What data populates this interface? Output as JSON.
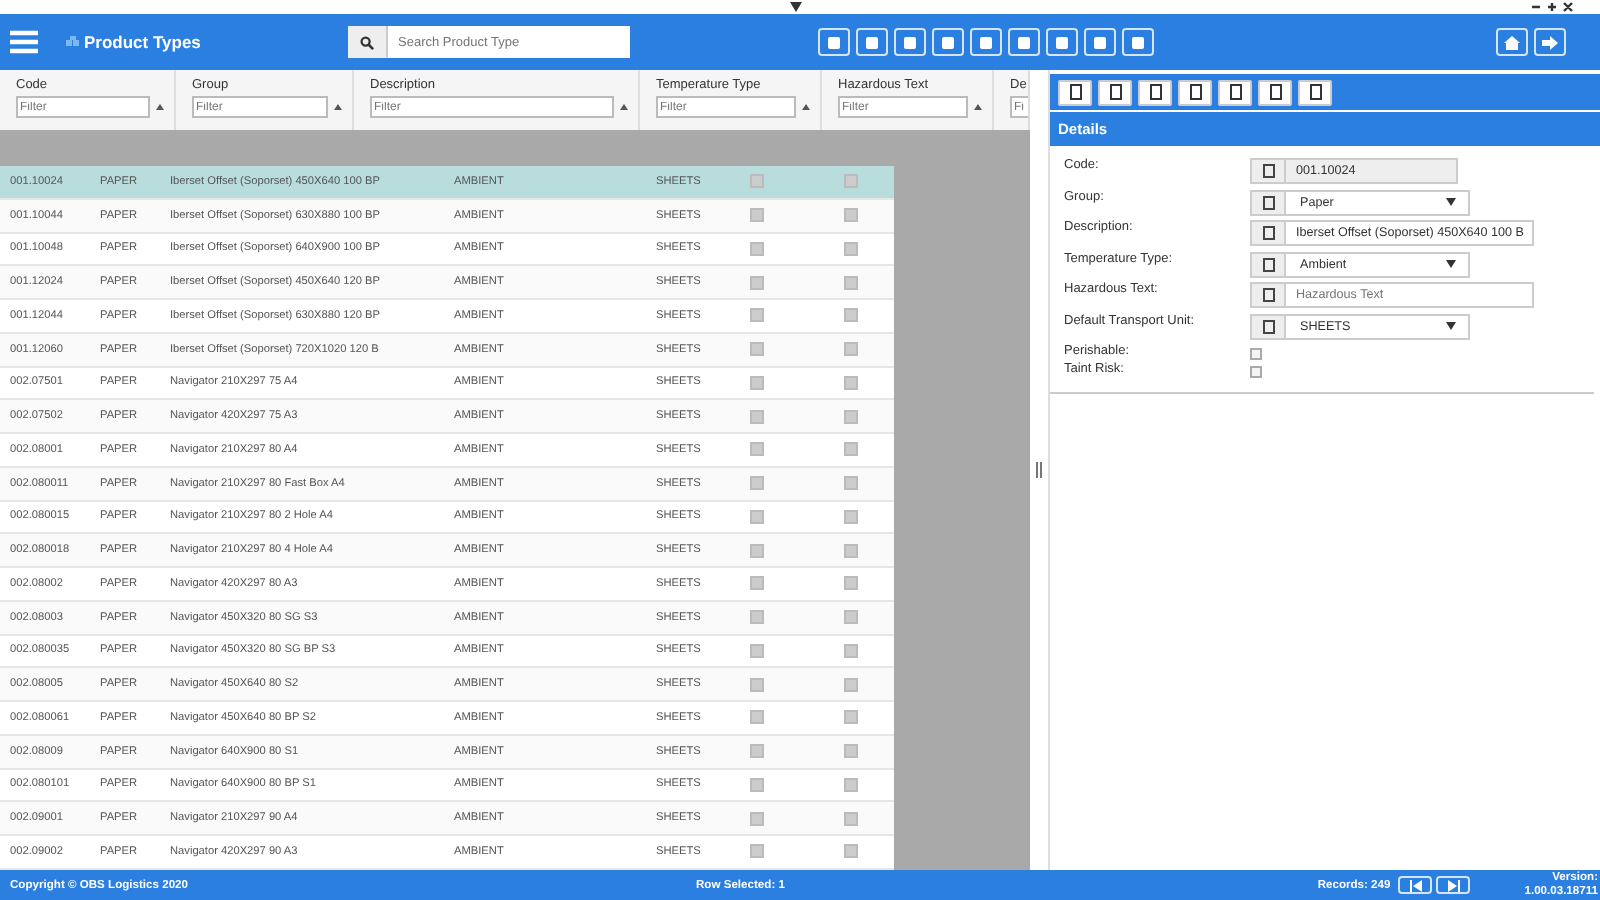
{
  "header": {
    "title": "Product Types",
    "search": {
      "placeholder": "Search Product Type"
    }
  },
  "filters": [
    {
      "label": "Code",
      "placeholder": "Filter"
    },
    {
      "label": "Group",
      "placeholder": "Filter"
    },
    {
      "label": "Description",
      "placeholder": "Filter"
    },
    {
      "label": "Temperature Type",
      "placeholder": "Filter"
    },
    {
      "label": "Hazardous Text",
      "placeholder": "Filter"
    },
    {
      "label": "De",
      "placeholder": "Fi"
    }
  ],
  "rows": [
    {
      "code": "001.10024",
      "group": "PAPER",
      "description": "Iberset Offset (Soporset) 450X640 100 BP",
      "temperature": "AMBIENT",
      "unit": "SHEETS",
      "check_a": false,
      "check_b": false,
      "selected": true
    },
    {
      "code": "001.10044",
      "group": "PAPER",
      "description": "Iberset Offset (Soporset) 630X880 100 BP",
      "temperature": "AMBIENT",
      "unit": "SHEETS",
      "check_a": false,
      "check_b": false,
      "selected": false
    },
    {
      "code": "001.10048",
      "group": "PAPER",
      "description": "Iberset Offset (Soporset) 640X900 100 BP",
      "temperature": "AMBIENT",
      "unit": "SHEETS",
      "check_a": false,
      "check_b": false,
      "selected": false
    },
    {
      "code": "001.12024",
      "group": "PAPER",
      "description": "Iberset Offset (Soporset) 450X640 120 BP",
      "temperature": "AMBIENT",
      "unit": "SHEETS",
      "check_a": false,
      "check_b": false,
      "selected": false
    },
    {
      "code": "001.12044",
      "group": "PAPER",
      "description": "Iberset Offset (Soporset) 630X880 120 BP",
      "temperature": "AMBIENT",
      "unit": "SHEETS",
      "check_a": false,
      "check_b": false,
      "selected": false
    },
    {
      "code": "001.12060",
      "group": "PAPER",
      "description": "Iberset Offset (Soporset) 720X1020 120 B",
      "temperature": "AMBIENT",
      "unit": "SHEETS",
      "check_a": false,
      "check_b": false,
      "selected": false
    },
    {
      "code": "002.07501",
      "group": "PAPER",
      "description": "Navigator 210X297 75 A4",
      "temperature": "AMBIENT",
      "unit": "SHEETS",
      "check_a": false,
      "check_b": false,
      "selected": false
    },
    {
      "code": "002.07502",
      "group": "PAPER",
      "description": "Navigator 420X297 75 A3",
      "temperature": "AMBIENT",
      "unit": "SHEETS",
      "check_a": false,
      "check_b": false,
      "selected": false
    },
    {
      "code": "002.08001",
      "group": "PAPER",
      "description": "Navigator 210X297 80 A4",
      "temperature": "AMBIENT",
      "unit": "SHEETS",
      "check_a": false,
      "check_b": false,
      "selected": false
    },
    {
      "code": "002.080011",
      "group": "PAPER",
      "description": "Navigator 210X297 80 Fast Box A4",
      "temperature": "AMBIENT",
      "unit": "SHEETS",
      "check_a": false,
      "check_b": false,
      "selected": false
    },
    {
      "code": "002.080015",
      "group": "PAPER",
      "description": "Navigator 210X297 80 2 Hole A4",
      "temperature": "AMBIENT",
      "unit": "SHEETS",
      "check_a": false,
      "check_b": false,
      "selected": false
    },
    {
      "code": "002.080018",
      "group": "PAPER",
      "description": "Navigator 210X297 80 4 Hole A4",
      "temperature": "AMBIENT",
      "unit": "SHEETS",
      "check_a": false,
      "check_b": false,
      "selected": false
    },
    {
      "code": "002.08002",
      "group": "PAPER",
      "description": "Navigator 420X297 80 A3",
      "temperature": "AMBIENT",
      "unit": "SHEETS",
      "check_a": false,
      "check_b": false,
      "selected": false
    },
    {
      "code": "002.08003",
      "group": "PAPER",
      "description": "Navigator 450X320 80 SG S3",
      "temperature": "AMBIENT",
      "unit": "SHEETS",
      "check_a": false,
      "check_b": false,
      "selected": false
    },
    {
      "code": "002.080035",
      "group": "PAPER",
      "description": "Navigator 450X320 80 SG BP S3",
      "temperature": "AMBIENT",
      "unit": "SHEETS",
      "check_a": false,
      "check_b": false,
      "selected": false
    },
    {
      "code": "002.08005",
      "group": "PAPER",
      "description": "Navigator 450X640 80 S2",
      "temperature": "AMBIENT",
      "unit": "SHEETS",
      "check_a": false,
      "check_b": false,
      "selected": false
    },
    {
      "code": "002.080061",
      "group": "PAPER",
      "description": "Navigator 450X640 80 BP S2",
      "temperature": "AMBIENT",
      "unit": "SHEETS",
      "check_a": false,
      "check_b": false,
      "selected": false
    },
    {
      "code": "002.08009",
      "group": "PAPER",
      "description": "Navigator 640X900 80 S1",
      "temperature": "AMBIENT",
      "unit": "SHEETS",
      "check_a": false,
      "check_b": false,
      "selected": false
    },
    {
      "code": "002.080101",
      "group": "PAPER",
      "description": "Navigator 640X900 80 BP S1",
      "temperature": "AMBIENT",
      "unit": "SHEETS",
      "check_a": false,
      "check_b": false,
      "selected": false
    },
    {
      "code": "002.09001",
      "group": "PAPER",
      "description": "Navigator 210X297 90 A4",
      "temperature": "AMBIENT",
      "unit": "SHEETS",
      "check_a": false,
      "check_b": false,
      "selected": false
    },
    {
      "code": "002.09002",
      "group": "PAPER",
      "description": "Navigator 420X297 90 A3",
      "temperature": "AMBIENT",
      "unit": "SHEETS",
      "check_a": false,
      "check_b": false,
      "selected": false
    }
  ],
  "details": {
    "title": "Details",
    "fields": [
      {
        "kind": "readonly",
        "label": "Code:",
        "value": "001.10024"
      },
      {
        "kind": "select",
        "label": "Group:",
        "value": "Paper"
      },
      {
        "kind": "text",
        "label": "Description:",
        "value": "Iberset Offset (Soporset) 450X640 100 B"
      },
      {
        "kind": "select",
        "label": "Temperature Type:",
        "value": "Ambient"
      },
      {
        "kind": "text",
        "label": "Hazardous Text:",
        "placeholder": "Hazardous Text"
      },
      {
        "kind": "select",
        "label": "Default Transport Unit:",
        "value": "SHEETS"
      },
      {
        "kind": "checkbox",
        "label": "Perishable:",
        "checked": false
      },
      {
        "kind": "checkbox",
        "label": "Taint Risk:",
        "checked": false
      }
    ]
  },
  "footer": {
    "copyright": "Copyright © OBS Logistics 2020",
    "row_selected": "Row Selected: 1",
    "records": "Records: 249",
    "version_label": "Version:",
    "version": "1.00.03.18711"
  }
}
